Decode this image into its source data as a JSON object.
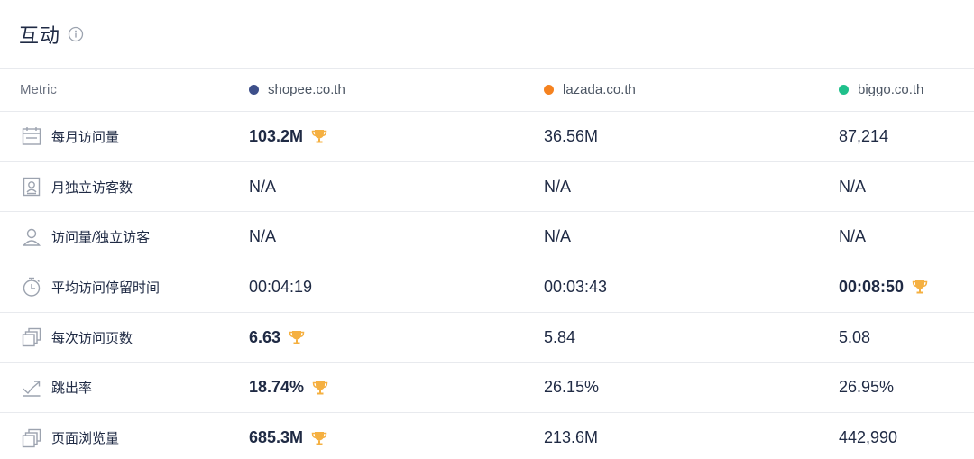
{
  "header": {
    "title": "互动"
  },
  "table": {
    "metric_header": "Metric",
    "sites": [
      {
        "name": "shopee.co.th",
        "color": "#3d4f8a"
      },
      {
        "name": "lazada.co.th",
        "color": "#f5821f"
      },
      {
        "name": "biggo.co.th",
        "color": "#1fc08b"
      }
    ],
    "rows": [
      {
        "label": "每月访问量",
        "icon": "calendar-icon",
        "values": [
          "103.2M",
          "36.56M",
          "87,214"
        ],
        "winner": 0
      },
      {
        "label": "月独立访客数",
        "icon": "id-card-icon",
        "values": [
          "N/A",
          "N/A",
          "N/A"
        ],
        "winner": -1
      },
      {
        "label": "访问量/独立访客",
        "icon": "user-icon",
        "values": [
          "N/A",
          "N/A",
          "N/A"
        ],
        "winner": -1
      },
      {
        "label": "平均访问停留时间",
        "icon": "stopwatch-icon",
        "values": [
          "00:04:19",
          "00:03:43",
          "00:08:50"
        ],
        "winner": 2
      },
      {
        "label": "每次访问页数",
        "icon": "pages-icon",
        "values": [
          "6.63",
          "5.84",
          "5.08"
        ],
        "winner": 0
      },
      {
        "label": "跳出率",
        "icon": "bounce-icon",
        "values": [
          "18.74%",
          "26.15%",
          "26.95%"
        ],
        "winner": 0
      },
      {
        "label": "页面浏览量",
        "icon": "pages-icon",
        "values": [
          "685.3M",
          "213.6M",
          "442,990"
        ],
        "winner": 0
      }
    ]
  }
}
